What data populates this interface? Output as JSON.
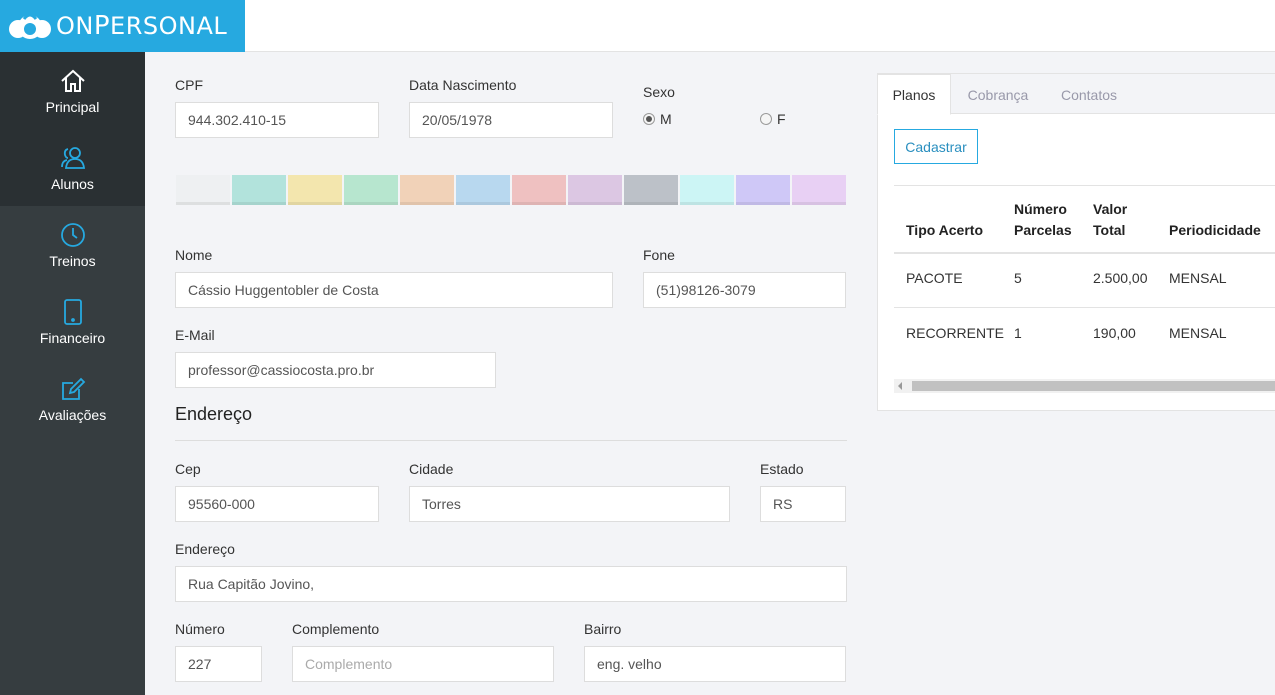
{
  "app": {
    "logo_text_1": "ON",
    "logo_text_2": "P",
    "logo_text_3": "ERSONAL"
  },
  "sidebar": {
    "items": [
      {
        "label": "Principal",
        "icon": "home-icon"
      },
      {
        "label": "Alunos",
        "icon": "users-icon"
      },
      {
        "label": "Treinos",
        "icon": "clock-icon"
      },
      {
        "label": "Financeiro",
        "icon": "tablet-icon"
      },
      {
        "label": "Avaliações",
        "icon": "edit-icon"
      }
    ]
  },
  "form": {
    "cpf_label": "CPF",
    "cpf_value": "944.302.410-15",
    "birth_label": "Data Nascimento",
    "birth_value": "20/05/1978",
    "sex_label": "Sexo",
    "sex_m": "M",
    "sex_f": "F",
    "name_label": "Nome",
    "name_value": "Cássio Huggentobler de Costa",
    "phone_label": "Fone",
    "phone_value": "(51)98126-3079",
    "email_label": "E-Mail",
    "email_value": "professor@cassiocosta.pro.br",
    "address_title": "Endereço",
    "cep_label": "Cep",
    "cep_value": "95560-000",
    "city_label": "Cidade",
    "city_value": "Torres",
    "state_label": "Estado",
    "state_value": "RS",
    "street_label": "Endereço",
    "street_value": "Rua Capitão Jovino,",
    "number_label": "Número",
    "number_value": "227",
    "complement_label": "Complemento",
    "complement_placeholder": "Complemento",
    "district_label": "Bairro",
    "district_value": "eng. velho"
  },
  "swatches": [
    "#eef0f2",
    "#b2e3dc",
    "#f3e6ae",
    "#b7e6cf",
    "#f1d2b8",
    "#b8d8ef",
    "#efc1c1",
    "#dcc7e3",
    "#bcc1c8",
    "#ccf5f5",
    "#cfc8f7",
    "#e8d0f4"
  ],
  "panel": {
    "tabs": [
      "Planos",
      "Cobrança",
      "Contatos"
    ],
    "button": "Cadastrar",
    "headers": {
      "tipo": "Tipo Acerto",
      "parcelas_1": "Número",
      "parcelas_2": "Parcelas",
      "valor_1": "Valor",
      "valor_2": "Total",
      "periodicidade": "Periodicidade"
    },
    "rows": [
      {
        "tipo": "PACOTE",
        "parcelas": "5",
        "valor": "2.500,00",
        "periodicidade": "MENSAL"
      },
      {
        "tipo": "RECORRENTE",
        "parcelas": "1",
        "valor": "190,00",
        "periodicidade": "MENSAL"
      }
    ]
  }
}
